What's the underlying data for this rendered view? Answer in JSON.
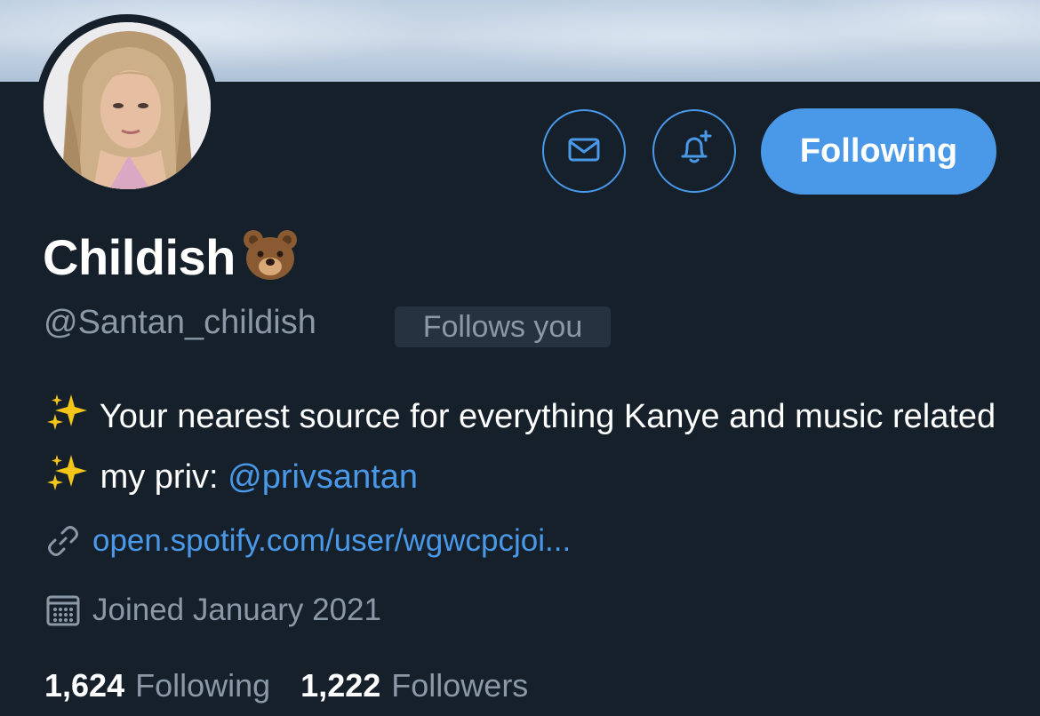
{
  "profile": {
    "display_name": "Childish",
    "name_emoji": "bear-face-emoji",
    "handle": "@Santan_childish",
    "follows_you_label": "Follows you",
    "bio": {
      "part1": "Your nearest source for everything Kanye and music related",
      "part2": "my priv:",
      "mention": "@privsantan",
      "emoji": "sparkles-emoji"
    },
    "website": "open.spotify.com/user/wgwcpcjoi...",
    "joined": "Joined January 2021"
  },
  "actions": {
    "message_icon": "envelope-icon",
    "notify_icon": "bell-plus-icon",
    "follow_label": "Following"
  },
  "stats": {
    "following_count": "1,624",
    "following_label": "Following",
    "followers_count": "1,222",
    "followers_label": "Followers"
  },
  "colors": {
    "background": "#15202b",
    "accent": "#4a99e9",
    "secondary_text": "#8b98a5",
    "badge_background": "#253341"
  }
}
